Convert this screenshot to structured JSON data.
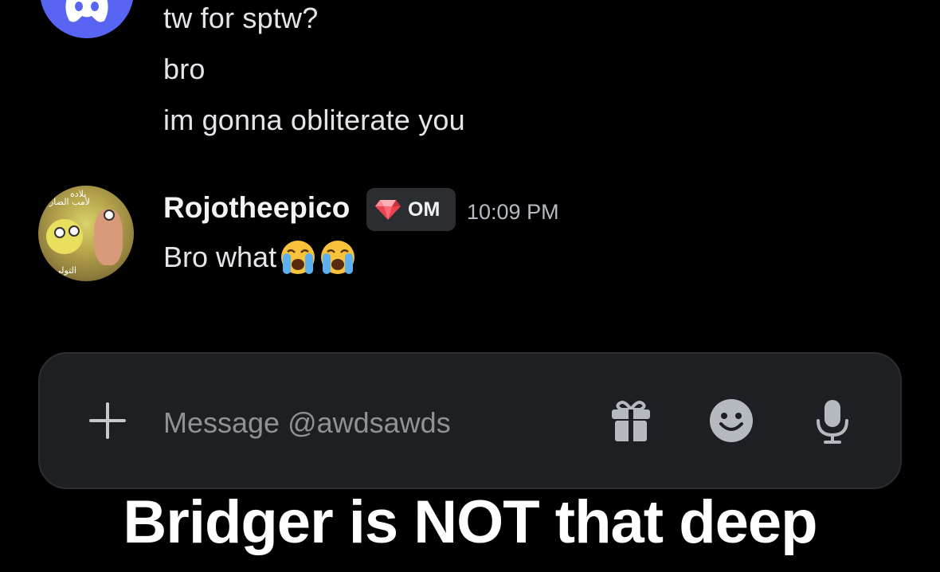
{
  "messages_top": [
    {
      "text": "tw for sptw?"
    },
    {
      "text": "bro"
    },
    {
      "text": "im gonna obliterate you"
    }
  ],
  "second_message": {
    "author": "Rojotheepico",
    "tag_label": "OM",
    "timestamp": "10:09 PM",
    "text": "Bro what",
    "emojis": [
      "loudly-crying-face",
      "loudly-crying-face"
    ]
  },
  "avatar_text": {
    "line1": "بلاده",
    "line2": "لأمب الضار",
    "line3": "التولي"
  },
  "composer": {
    "placeholder": "Message @awdsawds",
    "icons": [
      "plus-icon",
      "gift-icon",
      "emoji-icon",
      "mic-icon"
    ]
  },
  "caption": "Bridger is NOT that deep",
  "colors": {
    "background": "#000000",
    "discord_blurple": "#5865f2",
    "input_bg": "#1e1f22",
    "tag_bg": "#2b2d31",
    "timestamp": "#b5bac1",
    "placeholder": "#8e9297",
    "gem": "#e8434f"
  }
}
